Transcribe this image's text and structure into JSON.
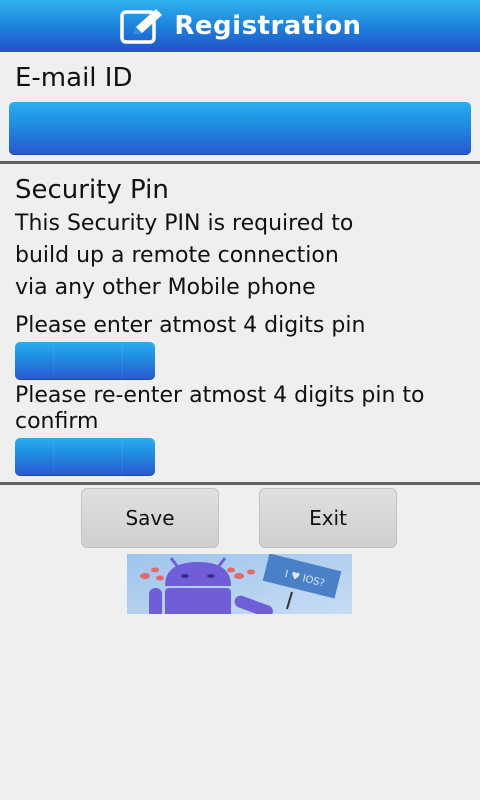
{
  "header": {
    "title": "Registration",
    "icon": "edit-note-icon"
  },
  "email": {
    "label": "E-mail ID",
    "value": ""
  },
  "security": {
    "heading": "Security Pin",
    "desc_line1": "This Security PIN is required to",
    "desc_line2": "build up a remote connection",
    "desc_line3": "via any other Mobile phone",
    "pin_prompt": "Please enter atmost 4 digits pin",
    "pin_value": "",
    "confirm_prompt_line1": "Please re-enter atmost 4 digits pin to",
    "confirm_prompt_line2": "confirm",
    "confirm_value": ""
  },
  "buttons": {
    "save": "Save",
    "exit": "Exit"
  },
  "banner": {
    "sign_text": "I ♥ IOS?"
  },
  "colors": {
    "accent_top": "#2fb2ee",
    "accent_bottom": "#2450c9",
    "android_purple": "#7060d8"
  }
}
